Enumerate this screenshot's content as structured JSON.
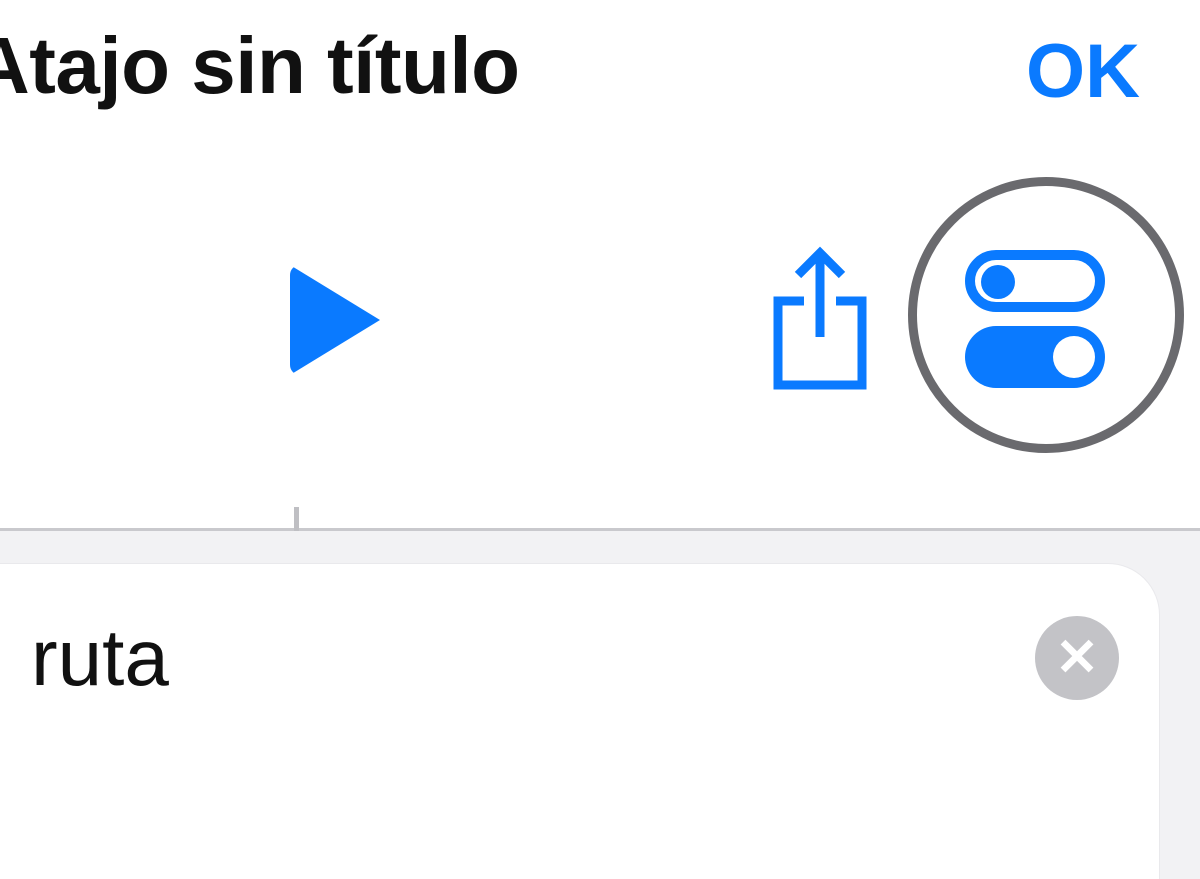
{
  "header": {
    "title": "Atajo sin título",
    "ok_label": "OK"
  },
  "toolbar": {
    "play_name": "play-icon",
    "share_name": "share-icon",
    "settings_name": "settings-toggles-icon"
  },
  "card": {
    "action_label": "ruta",
    "close_name": "close-icon"
  },
  "colors": {
    "accent": "#0a7aff",
    "muted_grey": "#c3c3c7",
    "circle_outline": "#6a6a6e"
  }
}
